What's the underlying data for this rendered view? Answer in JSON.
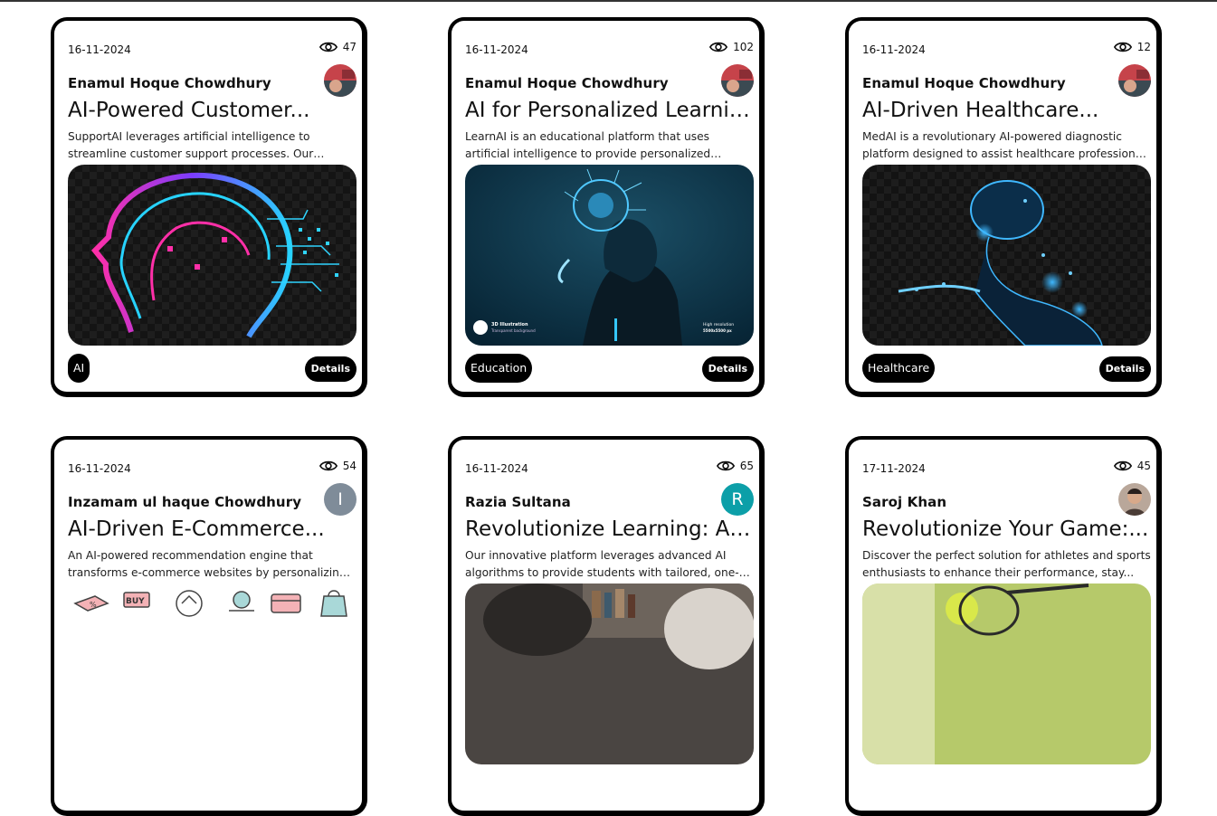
{
  "cards": [
    {
      "date": "16-11-2024",
      "views": "47",
      "author": "Enamul Hoque Chowdhury",
      "avatar_icon": "photo-avatar-icon",
      "title": "AI-Powered Customer...",
      "desc": "SupportAI leverages artificial intelligence to streamline customer support processes. Our platform uses AI-...",
      "tag": "AI",
      "details": "Details"
    },
    {
      "date": "16-11-2024",
      "views": "102",
      "author": "Enamul Hoque Chowdhury",
      "avatar_icon": "photo-avatar-icon",
      "title": "AI for Personalized Learning",
      "desc": "LearnAI is an educational platform that uses artificial intelligence to provide personalized learning...",
      "tag": "Education",
      "details": "Details",
      "image_text": {
        "left_title": "3D Illustration",
        "left_sub": "Transparent background",
        "right_title": "High resolution",
        "right_sub": "5500x5500 px"
      }
    },
    {
      "date": "16-11-2024",
      "views": "12",
      "author": "Enamul Hoque Chowdhury",
      "avatar_icon": "photo-avatar-icon",
      "title": "AI-Driven Healthcare...",
      "desc": "MedAI is a revolutionary AI-powered diagnostic platform designed to assist healthcare professionals in...",
      "tag": "Healthcare",
      "details": "Details"
    },
    {
      "date": "16-11-2024",
      "views": "54",
      "author": "Inzamam ul haque Chowdhury",
      "avatar_letter": "I",
      "avatar_color": "#7f8c99",
      "title": "AI-Driven E-Commerce...",
      "desc": "An AI-powered recommendation engine that transforms e-commerce websites by personalizing the shopping...",
      "image_text": {
        "buy": "BUY",
        "percent": "%"
      }
    },
    {
      "date": "16-11-2024",
      "views": "65",
      "author": "Razia Sultana",
      "avatar_letter": "R",
      "avatar_color": "#0c9fa8",
      "title": "Revolutionize Learning: AI-...",
      "desc": "Our innovative platform leverages advanced AI algorithms to provide students with tailored, one-on-..."
    },
    {
      "date": "17-11-2024",
      "views": "45",
      "author": "Saroj Khan",
      "avatar_icon": "photo-avatar-icon",
      "title": "Revolutionize Your Game:...",
      "desc": "Discover the perfect solution for athletes and sports enthusiasts to enhance their performance, stay..."
    }
  ]
}
